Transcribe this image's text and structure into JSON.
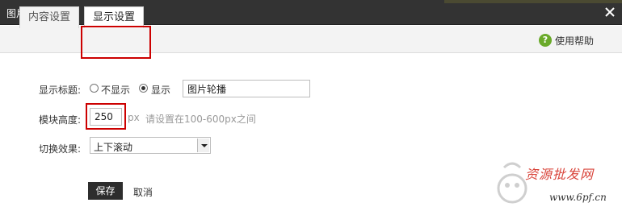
{
  "window": {
    "title": "图片轮播"
  },
  "tabs": [
    {
      "label": "内容设置",
      "active": false
    },
    {
      "label": "显示设置",
      "active": true
    }
  ],
  "help": {
    "label": "使用帮助"
  },
  "form": {
    "display_title": {
      "label": "显示标题:",
      "options": [
        {
          "label": "不显示",
          "checked": false
        },
        {
          "label": "显示",
          "checked": true
        }
      ],
      "value": "图片轮播"
    },
    "module_height": {
      "label": "模块高度:",
      "value": "250",
      "unit": "px",
      "hint": "请设置在100-600px之间"
    },
    "switch_effect": {
      "label": "切换效果:",
      "selected": "上下滚动"
    }
  },
  "actions": {
    "save": "保存",
    "cancel": "取消"
  },
  "watermark": {
    "line1": "资源批发网",
    "line2": "www.6pf.cn"
  },
  "colors": {
    "titlebar": "#333333",
    "highlight": "#cc0000",
    "save_button": "#2d2d2d",
    "help_icon": "#6aaa2a"
  }
}
